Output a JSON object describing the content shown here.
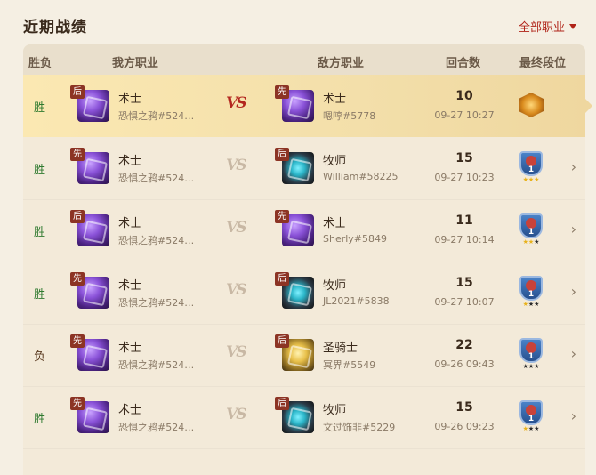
{
  "page": {
    "title": "近期战绩",
    "filter_label": "全部职业"
  },
  "columns": {
    "result": "胜负",
    "my_class": "我方职业",
    "enemy_class": "敌方职业",
    "turns": "回合数",
    "rank": "最终段位"
  },
  "vs_text": "VS",
  "rows": [
    {
      "result": "胜",
      "win": true,
      "my_order": "后",
      "my_class": "术士",
      "my_icon": "warlock",
      "my_player": "恐惧之鸦#524…",
      "enemy_order": "先",
      "enemy_class": "术士",
      "enemy_icon": "warlock",
      "enemy_player": "嗯哼#5778",
      "turns": "10",
      "time": "09-27 10:27",
      "rank_icon": "legend-gem",
      "rank_number": "",
      "stars": 0,
      "selected": true
    },
    {
      "result": "胜",
      "win": true,
      "my_order": "先",
      "my_class": "术士",
      "my_icon": "warlock",
      "my_player": "恐惧之鸦#524…",
      "enemy_order": "后",
      "enemy_class": "牧师",
      "enemy_icon": "priest",
      "enemy_player": "William#58225",
      "turns": "15",
      "time": "09-27 10:23",
      "rank_icon": "diamond-shield",
      "rank_number": "1",
      "stars": 3,
      "selected": false
    },
    {
      "result": "胜",
      "win": true,
      "my_order": "后",
      "my_class": "术士",
      "my_icon": "warlock",
      "my_player": "恐惧之鸦#524…",
      "enemy_order": "先",
      "enemy_class": "术士",
      "enemy_icon": "warlock",
      "enemy_player": "Sherly#5849",
      "turns": "11",
      "time": "09-27 10:14",
      "rank_icon": "diamond-shield",
      "rank_number": "1",
      "stars": 2,
      "selected": false
    },
    {
      "result": "胜",
      "win": true,
      "my_order": "先",
      "my_class": "术士",
      "my_icon": "warlock",
      "my_player": "恐惧之鸦#524…",
      "enemy_order": "后",
      "enemy_class": "牧师",
      "enemy_icon": "priest",
      "enemy_player": "JL2021#5838",
      "turns": "15",
      "time": "09-27 10:07",
      "rank_icon": "diamond-shield",
      "rank_number": "1",
      "stars": 1,
      "selected": false
    },
    {
      "result": "负",
      "win": false,
      "my_order": "先",
      "my_class": "术士",
      "my_icon": "warlock",
      "my_player": "恐惧之鸦#524…",
      "enemy_order": "后",
      "enemy_class": "圣骑士",
      "enemy_icon": "paladin",
      "enemy_player": "冥界#5549",
      "turns": "22",
      "time": "09-26 09:43",
      "rank_icon": "diamond-shield",
      "rank_number": "1",
      "stars": 0,
      "selected": false
    },
    {
      "result": "胜",
      "win": true,
      "my_order": "先",
      "my_class": "术士",
      "my_icon": "warlock",
      "my_player": "恐惧之鸦#524…",
      "enemy_order": "后",
      "enemy_class": "牧师",
      "enemy_icon": "priest",
      "enemy_player": "文过饰非#5229",
      "turns": "15",
      "time": "09-26 09:23",
      "rank_icon": "diamond-shield",
      "rank_number": "1",
      "stars": 1,
      "selected": false
    }
  ]
}
